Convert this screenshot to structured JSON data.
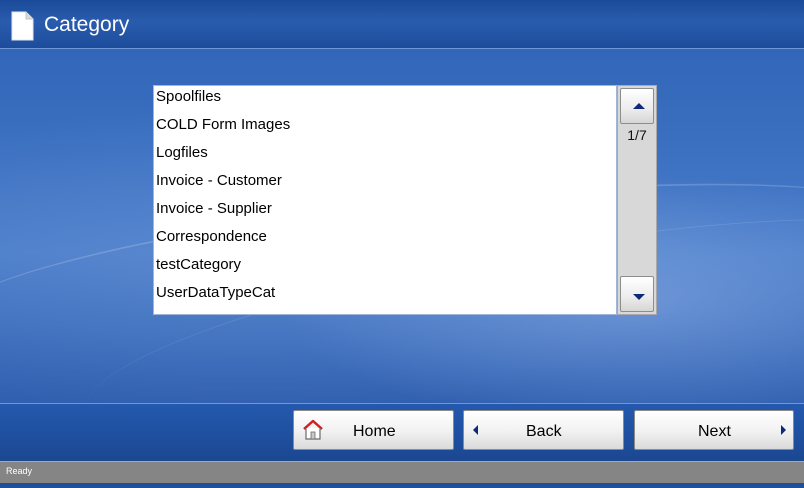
{
  "window": {
    "title": "Category"
  },
  "list": {
    "items": [
      "Spoolfiles",
      "COLD Form Images",
      "Logfiles",
      "Invoice - Customer",
      "Invoice - Supplier",
      "Correspondence",
      "testCategory",
      "UserDataTypeCat"
    ]
  },
  "scrollbar": {
    "page_indicator": "1/7"
  },
  "buttons": {
    "home": "Home",
    "back": "Back",
    "next": "Next"
  },
  "status": {
    "text": "Ready"
  },
  "icons": {
    "title": "document-icon",
    "home": "home-icon",
    "back": "arrow-left-icon",
    "next": "arrow-right-icon",
    "scroll_up": "arrow-up-icon",
    "scroll_down": "arrow-down-icon"
  },
  "colors": {
    "background": "#2d61b4",
    "titlebar": "#1d4c9b",
    "arrow": "#0d2a78",
    "statusbar": "#858585"
  }
}
